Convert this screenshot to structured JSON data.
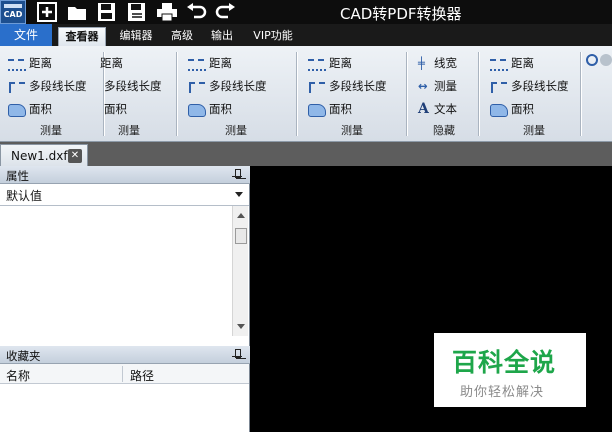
{
  "window": {
    "title": "CAD转PDF转换器",
    "app_icon_label": "CAD"
  },
  "quick_access": [
    "add-icon",
    "open-folder-icon",
    "save-icon",
    "save-as-icon",
    "print-icon",
    "undo-icon",
    "redo-icon"
  ],
  "tabs": [
    {
      "label": "文件"
    },
    {
      "label": "查看器"
    },
    {
      "label": "编辑器"
    },
    {
      "label": "高级"
    },
    {
      "label": "输出"
    },
    {
      "label": "VIP功能"
    }
  ],
  "ribbon": {
    "groups": [
      {
        "items": [
          "距离",
          "多段线长度",
          "面积"
        ],
        "label": "测量"
      },
      {
        "items": [
          "距离",
          "多段线长度",
          "面积"
        ],
        "label": "测量"
      },
      {
        "items": [
          "距离",
          "多段线长度",
          "面积"
        ],
        "label": "测量"
      },
      {
        "items": [
          "距离",
          "多段线长度",
          "面积"
        ],
        "label": "测量"
      },
      {
        "items": [
          "线宽",
          "测量",
          "文本"
        ],
        "label": "隐藏"
      },
      {
        "items": [
          "距离",
          "多段线长度",
          "面积"
        ],
        "label": "测量"
      }
    ]
  },
  "document_tab": {
    "name": "New1.dxf",
    "close_glyph": "✕"
  },
  "properties_panel": {
    "title": "属性",
    "dropdown_value": "默认值"
  },
  "favorites_panel": {
    "title": "收藏夹",
    "columns": [
      "名称",
      "路径"
    ]
  },
  "watermark": {
    "main": "百科全说",
    "sub": "助你轻松解决"
  },
  "colors": {
    "file_tab": "#2a6fcb",
    "canvas": "#000000",
    "ribbon": "#e3e8ee",
    "watermark_green": "#1ea64a"
  }
}
